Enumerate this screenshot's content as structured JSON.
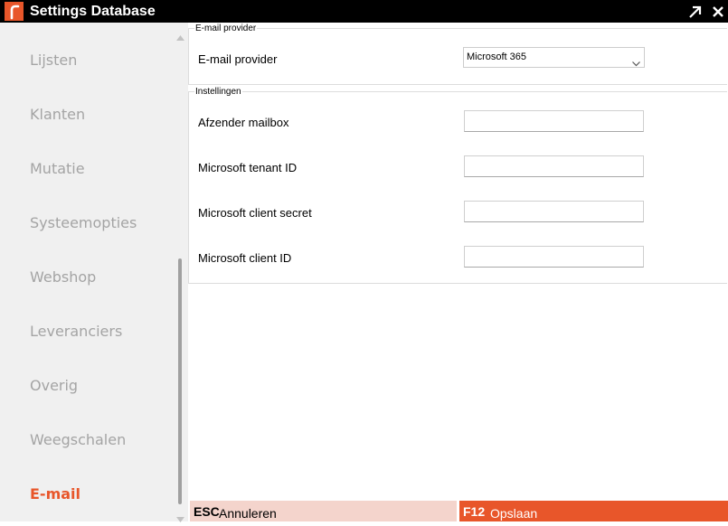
{
  "window": {
    "title": "Settings Database",
    "icons": [
      "app-logo-icon",
      "restore-icon",
      "close-icon"
    ]
  },
  "colors": {
    "accent": "#e8562a",
    "titlebar": "#000000",
    "sidebar_bg": "#f0f0f0",
    "nav_text": "#a4a4a4",
    "cancel_bg": "#f4d4cc"
  },
  "sidebar": {
    "items": [
      {
        "label": "Lijsten"
      },
      {
        "label": "Klanten"
      },
      {
        "label": "Mutatie"
      },
      {
        "label": "Systeemopties"
      },
      {
        "label": "Webshop"
      },
      {
        "label": "Leveranciers"
      },
      {
        "label": "Overig"
      },
      {
        "label": "Weegschalen"
      },
      {
        "label": "E-mail",
        "active": true
      }
    ]
  },
  "email_provider_group": {
    "legend": "E-mail provider",
    "provider_label": "E-mail provider",
    "provider_value": "Microsoft 365"
  },
  "settings_group": {
    "legend": "Instellingen",
    "fields": [
      {
        "label": "Afzender mailbox",
        "value": ""
      },
      {
        "label": "Microsoft tenant ID",
        "value": ""
      },
      {
        "label": "Microsoft client secret",
        "value": ""
      },
      {
        "label": "Microsoft client ID",
        "value": ""
      }
    ]
  },
  "footer": {
    "cancel_key": "ESC",
    "cancel_label": "Annuleren",
    "save_key": "F12",
    "save_label": "Opslaan"
  }
}
